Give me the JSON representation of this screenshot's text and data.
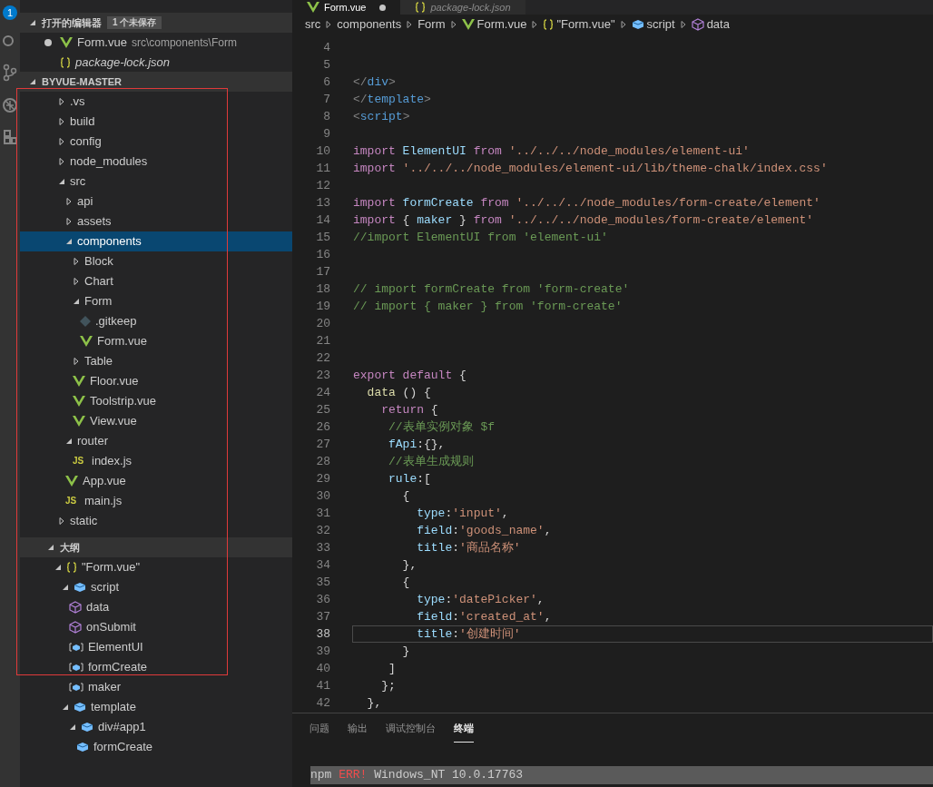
{
  "activity_bar": {
    "badge": "1"
  },
  "editor_tabs": [
    {
      "label": "Form.vue",
      "selected": true,
      "dirty": true,
      "kind": "vue"
    },
    {
      "label": "package-lock.json",
      "selected": false,
      "dirty": false,
      "kind": "braces"
    }
  ],
  "open_editors": {
    "title": "打开的编辑器",
    "badge": "1 个未保存",
    "expanded": true,
    "items": [
      {
        "name": "Form.vue",
        "path": "src\\components\\Form",
        "kind": "vue",
        "dirty": true,
        "italic": false
      },
      {
        "name": "package-lock.json",
        "kind": "braces",
        "dirty": false,
        "italic": true
      }
    ]
  },
  "explorer": {
    "title": "BYVUE-MASTER",
    "expanded": true,
    "tree": [
      {
        "name": ".vs",
        "kind": "folder",
        "expanded": false,
        "selected": false
      },
      {
        "name": "build",
        "kind": "folder",
        "expanded": false,
        "selected": false
      },
      {
        "name": "config",
        "kind": "folder",
        "expanded": false,
        "selected": false
      },
      {
        "name": "node_modules",
        "kind": "folder",
        "expanded": false,
        "selected": false
      },
      {
        "name": "src",
        "kind": "folder",
        "expanded": true,
        "selected": false,
        "children": [
          {
            "name": "api",
            "kind": "folder",
            "expanded": false,
            "selected": false
          },
          {
            "name": "assets",
            "kind": "folder",
            "expanded": false,
            "selected": false
          },
          {
            "name": "components",
            "kind": "folder",
            "expanded": true,
            "selected": true,
            "children": [
              {
                "name": "Block",
                "kind": "folder",
                "expanded": false,
                "selected": false
              },
              {
                "name": "Chart",
                "kind": "folder",
                "expanded": false,
                "selected": false
              },
              {
                "name": "Form",
                "kind": "folder",
                "expanded": true,
                "selected": false,
                "children": [
                  {
                    "name": ".gitkeep",
                    "kind": "git",
                    "selected": false
                  },
                  {
                    "name": "Form.vue",
                    "kind": "vue",
                    "selected": false
                  }
                ]
              },
              {
                "name": "Table",
                "kind": "folder",
                "expanded": false,
                "selected": false
              },
              {
                "name": "Floor.vue",
                "kind": "vue",
                "selected": false
              },
              {
                "name": "Toolstrip.vue",
                "kind": "vue",
                "selected": false
              },
              {
                "name": "View.vue",
                "kind": "vue",
                "selected": false
              }
            ]
          },
          {
            "name": "router",
            "kind": "folder",
            "expanded": true,
            "selected": false,
            "children": [
              {
                "name": "index.js",
                "kind": "js",
                "icon_text": "JS",
                "selected": false
              }
            ]
          },
          {
            "name": "App.vue",
            "kind": "vue",
            "selected": false
          },
          {
            "name": "main.js",
            "kind": "js",
            "icon_text": "JS",
            "selected": false
          }
        ]
      },
      {
        "name": "static",
        "kind": "folder",
        "expanded": false,
        "selected": false
      }
    ]
  },
  "outline": {
    "title": "大纲",
    "expanded": true,
    "tree": [
      {
        "name": "\"Form.vue\"",
        "kind": "braces",
        "expanded": true,
        "children": [
          {
            "name": "script",
            "kind": "module",
            "expanded": true,
            "children": [
              {
                "name": "data",
                "kind": "method"
              },
              {
                "name": "onSubmit",
                "kind": "method"
              },
              {
                "name": "ElementUI",
                "kind": "variable"
              },
              {
                "name": "formCreate",
                "kind": "variable"
              },
              {
                "name": "maker",
                "kind": "variable"
              }
            ]
          },
          {
            "name": "template",
            "kind": "module",
            "expanded": true,
            "children": [
              {
                "name": "div#app1",
                "kind": "module",
                "expanded": true,
                "children": [
                  {
                    "name": "formCreate",
                    "kind": "module"
                  }
                ]
              }
            ]
          }
        ]
      }
    ]
  },
  "breadcrumb": [
    {
      "label": "src",
      "kind": "folder"
    },
    {
      "label": "components",
      "kind": "folder"
    },
    {
      "label": "Form",
      "kind": "folder"
    },
    {
      "label": "Form.vue",
      "kind": "vue"
    },
    {
      "label": "\"Form.vue\"",
      "kind": "braces"
    },
    {
      "label": "script",
      "kind": "module"
    },
    {
      "label": "data",
      "kind": "method"
    }
  ],
  "code_lines": [
    {
      "no": "4",
      "current": false
    },
    {
      "no": "5",
      "current": false
    },
    {
      "no": "6",
      "current": false,
      "tokens": [
        {
          "kind": "punct",
          "text": "</"
        },
        {
          "kind": "tag",
          "text": "div"
        },
        {
          "kind": "punct",
          "text": ">"
        }
      ]
    },
    {
      "no": "7",
      "current": false,
      "tokens": [
        {
          "kind": "punct",
          "text": "</"
        },
        {
          "kind": "tag",
          "text": "template"
        },
        {
          "kind": "punct",
          "text": ">"
        }
      ]
    },
    {
      "no": "8",
      "current": false,
      "tokens": [
        {
          "kind": "punct",
          "text": "<"
        },
        {
          "kind": "tag",
          "text": "script"
        },
        {
          "kind": "punct",
          "text": ">"
        }
      ]
    },
    {
      "no": "9",
      "current": false
    },
    {
      "no": "10",
      "current": false,
      "tokens": [
        {
          "kind": "keyword",
          "text": "import"
        },
        {
          "kind": "ident",
          "text": " ElementUI "
        },
        {
          "kind": "keyword",
          "text": "from"
        },
        {
          "kind": "string",
          "text": " '../../../node_modules/element-ui'"
        }
      ]
    },
    {
      "no": "11",
      "current": false,
      "tokens": [
        {
          "kind": "keyword",
          "text": "import"
        },
        {
          "kind": "string",
          "text": " '../../../node_modules/element-ui/lib/theme-chalk/index.css'"
        }
      ]
    },
    {
      "no": "12",
      "current": false
    },
    {
      "no": "13",
      "current": false,
      "tokens": [
        {
          "kind": "keyword",
          "text": "import"
        },
        {
          "kind": "ident",
          "text": " formCreate "
        },
        {
          "kind": "keyword",
          "text": "from"
        },
        {
          "kind": "string",
          "text": " '../../../node_modules/form-create/element'"
        }
      ]
    },
    {
      "no": "14",
      "current": false,
      "tokens": [
        {
          "kind": "keyword",
          "text": "import"
        },
        {
          "kind": "text",
          "text": " { "
        },
        {
          "kind": "ident",
          "text": "maker"
        },
        {
          "kind": "text",
          "text": " } "
        },
        {
          "kind": "keyword",
          "text": "from"
        },
        {
          "kind": "string",
          "text": " '../../../node_modules/form-create/element'"
        }
      ]
    },
    {
      "no": "15",
      "current": false,
      "tokens": [
        {
          "kind": "comment",
          "text": "//import ElementUI from 'element-ui'"
        }
      ]
    },
    {
      "no": "16",
      "current": false
    },
    {
      "no": "17",
      "current": false
    },
    {
      "no": "18",
      "current": false,
      "tokens": [
        {
          "kind": "comment",
          "text": "// import formCreate from 'form-create'"
        }
      ]
    },
    {
      "no": "19",
      "current": false,
      "tokens": [
        {
          "kind": "comment",
          "text": "// import { maker } from 'form-create'"
        }
      ]
    },
    {
      "no": "20",
      "current": false
    },
    {
      "no": "21",
      "current": false
    },
    {
      "no": "22",
      "current": false
    },
    {
      "no": "23",
      "current": false,
      "tokens": [
        {
          "kind": "keyword",
          "text": "export default"
        },
        {
          "kind": "text",
          "text": " {"
        }
      ]
    },
    {
      "no": "24",
      "current": false,
      "tokens": [
        {
          "kind": "function",
          "text": "  data"
        },
        {
          "kind": "text",
          "text": " () {"
        }
      ]
    },
    {
      "no": "25",
      "current": false,
      "tokens": [
        {
          "kind": "keyword",
          "text": "    return"
        },
        {
          "kind": "text",
          "text": " {"
        }
      ]
    },
    {
      "no": "26",
      "current": false,
      "tokens": [
        {
          "kind": "comment",
          "text": "     //表单实例对象 $f"
        }
      ]
    },
    {
      "no": "27",
      "current": false,
      "tokens": [
        {
          "kind": "ident",
          "text": "     fApi"
        },
        {
          "kind": "text",
          "text": ":{},"
        }
      ]
    },
    {
      "no": "28",
      "current": false,
      "tokens": [
        {
          "kind": "comment",
          "text": "     //表单生成规则"
        }
      ]
    },
    {
      "no": "29",
      "current": false,
      "tokens": [
        {
          "kind": "ident",
          "text": "     rule"
        },
        {
          "kind": "text",
          "text": ":["
        }
      ]
    },
    {
      "no": "30",
      "current": false,
      "tokens": [
        {
          "kind": "text",
          "text": "       {"
        }
      ]
    },
    {
      "no": "31",
      "current": false,
      "tokens": [
        {
          "kind": "ident",
          "text": "         type"
        },
        {
          "kind": "text",
          "text": ":"
        },
        {
          "kind": "string",
          "text": "'input'"
        },
        {
          "kind": "text",
          "text": ","
        }
      ]
    },
    {
      "no": "32",
      "current": false,
      "tokens": [
        {
          "kind": "ident",
          "text": "         field"
        },
        {
          "kind": "text",
          "text": ":"
        },
        {
          "kind": "string",
          "text": "'goods_name'"
        },
        {
          "kind": "text",
          "text": ","
        }
      ]
    },
    {
      "no": "33",
      "current": false,
      "tokens": [
        {
          "kind": "ident",
          "text": "         title"
        },
        {
          "kind": "text",
          "text": ":"
        },
        {
          "kind": "string",
          "text": "'商品名称'"
        }
      ]
    },
    {
      "no": "34",
      "current": false,
      "tokens": [
        {
          "kind": "text",
          "text": "       },"
        }
      ]
    },
    {
      "no": "35",
      "current": false,
      "tokens": [
        {
          "kind": "text",
          "text": "       {"
        }
      ]
    },
    {
      "no": "36",
      "current": false,
      "tokens": [
        {
          "kind": "ident",
          "text": "         type"
        },
        {
          "kind": "text",
          "text": ":"
        },
        {
          "kind": "string",
          "text": "'datePicker'"
        },
        {
          "kind": "text",
          "text": ","
        }
      ]
    },
    {
      "no": "37",
      "current": false,
      "tokens": [
        {
          "kind": "ident",
          "text": "         field"
        },
        {
          "kind": "text",
          "text": ":"
        },
        {
          "kind": "string",
          "text": "'created_at'"
        },
        {
          "kind": "text",
          "text": ","
        }
      ]
    },
    {
      "no": "38",
      "current": true,
      "tokens": [
        {
          "kind": "ident",
          "text": "         title"
        },
        {
          "kind": "text",
          "text": ":"
        },
        {
          "kind": "string",
          "text": "'创建时间'"
        }
      ]
    },
    {
      "no": "39",
      "current": false,
      "tokens": [
        {
          "kind": "text",
          "text": "       }"
        }
      ]
    },
    {
      "no": "40",
      "current": false,
      "tokens": [
        {
          "kind": "text",
          "text": "     ]"
        }
      ]
    },
    {
      "no": "41",
      "current": false,
      "tokens": [
        {
          "kind": "text",
          "text": "    };"
        }
      ]
    },
    {
      "no": "42",
      "current": false,
      "tokens": [
        {
          "kind": "text",
          "text": "  },"
        }
      ]
    }
  ],
  "panel_tabs": [
    {
      "label": "问题",
      "selected": false
    },
    {
      "label": "输出",
      "selected": false
    },
    {
      "label": "调试控制台",
      "selected": false
    },
    {
      "label": "终端",
      "selected": true
    }
  ],
  "terminal": [
    {
      "kind": "text",
      "text": "npm "
    },
    {
      "kind": "error",
      "text": "ERR!"
    },
    {
      "kind": "text",
      "text": " Windows_NT 10.0.17763"
    }
  ]
}
